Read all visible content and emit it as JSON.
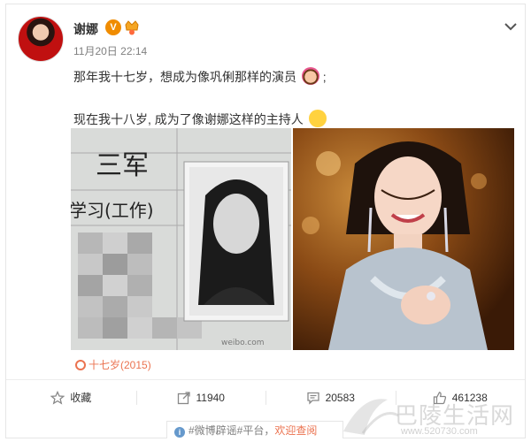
{
  "post": {
    "author": "谢娜",
    "verified_mark": "V",
    "time": "11月20日 22:14",
    "line1": "那年我十七岁，想成为像巩俐那样的演员",
    "line1_suffix": ";",
    "line2": "现在我十八岁, 成为了像谢娜这样的主持人",
    "location": "十七岁(2015)"
  },
  "photos": {
    "left": {
      "handwriting": "三军",
      "form_label": "学习(工作)",
      "source_mark": "weibo.com"
    },
    "right": {}
  },
  "actions": [
    {
      "label": "收藏",
      "icon": "star-icon"
    },
    {
      "label": "11940",
      "icon": "forward-icon"
    },
    {
      "label": "20583",
      "icon": "comment-icon"
    },
    {
      "label": "461238",
      "icon": "like-icon"
    }
  ],
  "rumor": {
    "tag": "#微博辟谣#平台，",
    "link": "欢迎查阅"
  },
  "watermark": {
    "text": "巴陵生活网",
    "url": "www.520730.com"
  },
  "colors": {
    "accent": "#eb7350",
    "verified": "#f08c00",
    "info": "#6699cc"
  }
}
